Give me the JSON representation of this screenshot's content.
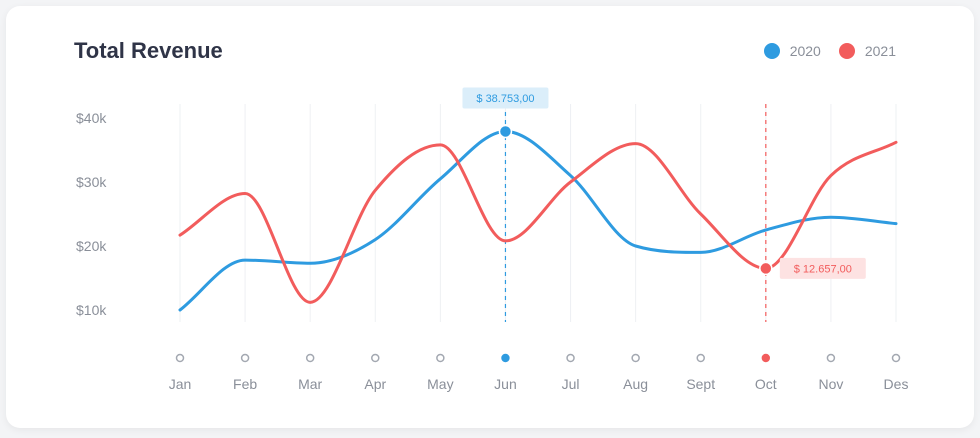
{
  "card": {
    "title": "Total Revenue"
  },
  "colors": {
    "blue": "#2e9be0",
    "red": "#f25c5c",
    "grid": "#eef0f3",
    "muted": "#8a8f99"
  },
  "chart_data": {
    "type": "line",
    "title": "Total Revenue",
    "xlabel": "",
    "ylabel": "",
    "categories": [
      "Jan",
      "Feb",
      "Mar",
      "Apr",
      "May",
      "Jun",
      "Jul",
      "Aug",
      "Sept",
      "Oct",
      "Nov",
      "Des"
    ],
    "y_ticks": [
      "$10k",
      "$20k",
      "$30k",
      "$40k"
    ],
    "ylim": [
      10000,
      40000
    ],
    "grid": true,
    "legend_position": "top-right",
    "series": [
      {
        "name": "2020",
        "color": "#2e9be0",
        "values": [
          10000,
          17800,
          17300,
          21000,
          30500,
          37900,
          31000,
          20000,
          19000,
          22500,
          24500,
          23500
        ]
      },
      {
        "name": "2021",
        "color": "#f25c5c",
        "values": [
          21700,
          28200,
          11200,
          28700,
          35800,
          20800,
          30000,
          36000,
          25000,
          16500,
          31000,
          36200
        ]
      }
    ],
    "x_markers": [
      {
        "index": 5,
        "state": "active",
        "color": "#2e9be0"
      },
      {
        "index": 9,
        "state": "active",
        "color": "#f25c5c"
      }
    ],
    "annotations": [
      {
        "series": 0,
        "index": 5,
        "label": "$ 38.753,00",
        "placement": "above"
      },
      {
        "series": 1,
        "index": 9,
        "label": "$ 12.657,00",
        "placement": "right"
      }
    ]
  }
}
